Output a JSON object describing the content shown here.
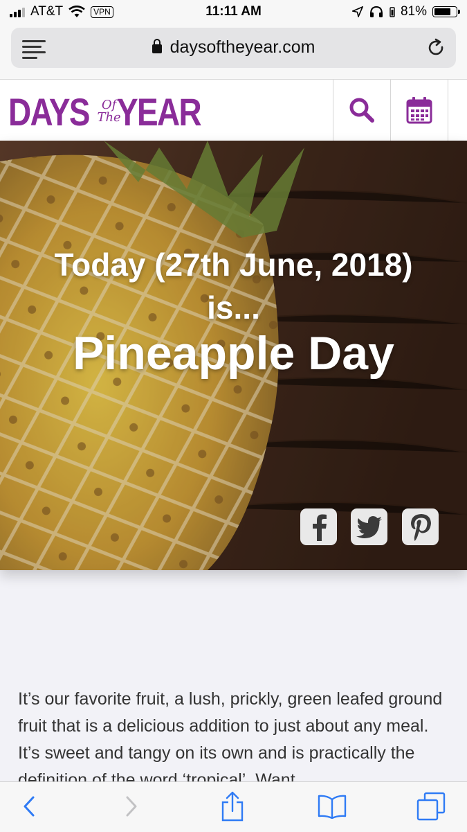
{
  "status_bar": {
    "carrier": "AT&T",
    "vpn_label": "VPN",
    "time": "11:11 AM",
    "battery_percent": "81%",
    "battery_level": 0.81
  },
  "browser": {
    "url": "daysoftheyear.com"
  },
  "site": {
    "logo_left": "DAYS",
    "logo_of": "Of",
    "logo_the": "The",
    "logo_right": "YEAR",
    "brand_color": "#8a2c99"
  },
  "hero": {
    "intro": "Today (27th June, 2018) is...",
    "title": "Pineapple Day"
  },
  "social": [
    "facebook-icon",
    "twitter-icon",
    "pinterest-icon"
  ],
  "article": {
    "text": "It’s our favorite fruit, a lush, prickly, green leafed ground fruit that is a delicious addition to just about any meal. It’s sweet and tangy on its own and is practically the definition of the word ‘tropical’. Want"
  },
  "toolbar": [
    "back-icon",
    "forward-icon",
    "share-icon",
    "bookmarks-icon",
    "tabs-icon"
  ]
}
